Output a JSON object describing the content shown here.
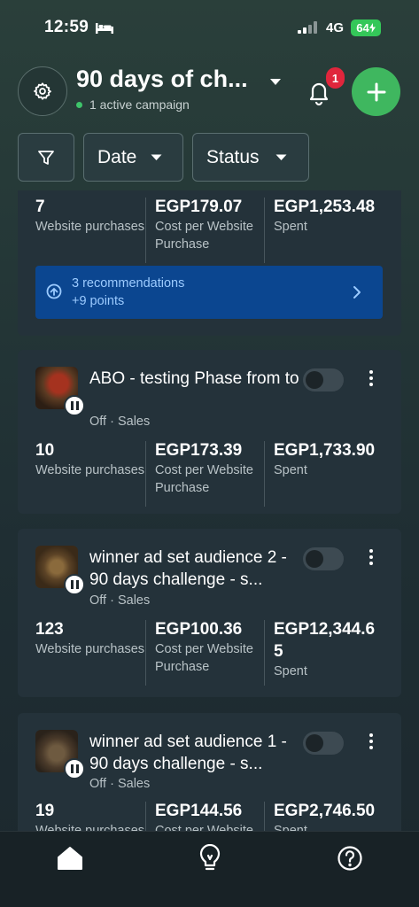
{
  "status_bar": {
    "time": "12:59",
    "network": "4G",
    "battery": "64"
  },
  "header": {
    "account_title": "90 days of ch...",
    "active_campaigns": "1 active campaign",
    "notification_count": "1"
  },
  "filters": {
    "date_label": "Date",
    "status_label": "Status"
  },
  "cards": [
    {
      "metrics": [
        {
          "value": "7",
          "label": "Website purchases"
        },
        {
          "value": "EGP179.07",
          "label": "Cost per Website Purchase"
        },
        {
          "value": "EGP1,253.48",
          "label": "Spent"
        }
      ],
      "recommendation": {
        "title": "3 recommendations",
        "points": "+9 points"
      }
    },
    {
      "title": "ABO - testing Phase from to",
      "status": "Off",
      "objective": "Sales",
      "toggle_on": false,
      "metrics": [
        {
          "value": "10",
          "label": "Website purchases"
        },
        {
          "value": "EGP173.39",
          "label": "Cost per Website Purchase"
        },
        {
          "value": "EGP1,733.90",
          "label": "Spent"
        }
      ]
    },
    {
      "title": "winner ad set audience 2 - 90 days challenge - s...",
      "status": "Off",
      "objective": "Sales",
      "toggle_on": false,
      "metrics": [
        {
          "value": "123",
          "label": "Website purchases"
        },
        {
          "value": "EGP100.36",
          "label": "Cost per Website Purchase"
        },
        {
          "value": "EGP12,344.65",
          "label": "Spent"
        }
      ]
    },
    {
      "title": "winner ad set audience 1 - 90 days challenge - s...",
      "status": "Off",
      "objective": "Sales",
      "toggle_on": false,
      "metrics": [
        {
          "value": "19",
          "label": "Website purchases"
        },
        {
          "value": "EGP144.56",
          "label": "Cost per Website Purchase"
        },
        {
          "value": "EGP2,746.50",
          "label": "Spent"
        }
      ]
    }
  ],
  "bottom_nav": [
    {
      "icon": "home-icon",
      "active": true
    },
    {
      "icon": "lightbulb-icon",
      "active": false
    },
    {
      "icon": "help-icon",
      "active": false
    }
  ],
  "colors": {
    "accent_green": "#3fb75f",
    "badge_red": "#e0263c",
    "recommendation_blue": "#0b4690",
    "card_bg": "#24323a"
  }
}
